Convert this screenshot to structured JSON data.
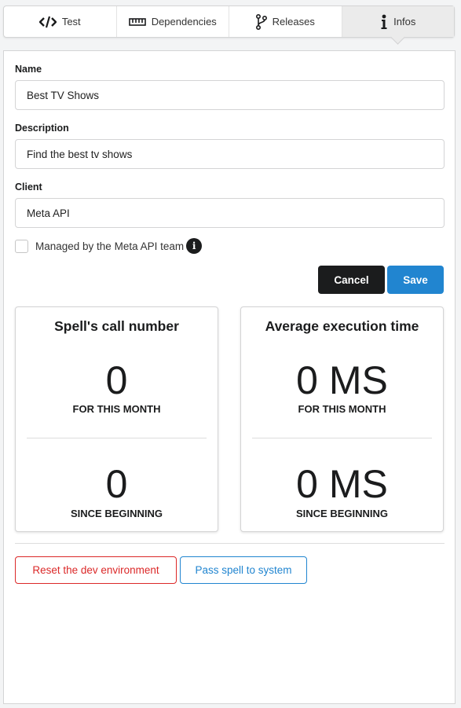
{
  "tabs": [
    {
      "label": "Test",
      "icon": "code-icon"
    },
    {
      "label": "Dependencies",
      "icon": "dependencies-icon"
    },
    {
      "label": "Releases",
      "icon": "branch-icon"
    },
    {
      "label": "Infos",
      "icon": "info-icon",
      "active": true
    }
  ],
  "form": {
    "name_label": "Name",
    "name_value": "Best TV Shows",
    "description_label": "Description",
    "description_value": "Find the best tv shows",
    "client_label": "Client",
    "client_value": "Meta API",
    "managed_label": "Managed by the Meta API team",
    "managed_checked": false,
    "cancel_label": "Cancel",
    "save_label": "Save"
  },
  "stats": {
    "calls": {
      "title": "Spell's call number",
      "month_value": "0",
      "month_label": "FOR THIS MONTH",
      "total_value": "0",
      "total_label": "SINCE BEGINNING"
    },
    "execution": {
      "title": "Average execution time",
      "month_value": "0 MS",
      "month_label": "FOR THIS MONTH",
      "total_value": "0 MS",
      "total_label": "SINCE BEGINNING"
    }
  },
  "actions": {
    "reset_label": "Reset the dev environment",
    "pass_label": "Pass spell to system"
  },
  "colors": {
    "primary": "#2185d0",
    "dark": "#1b1c1d",
    "danger": "#db2828"
  }
}
